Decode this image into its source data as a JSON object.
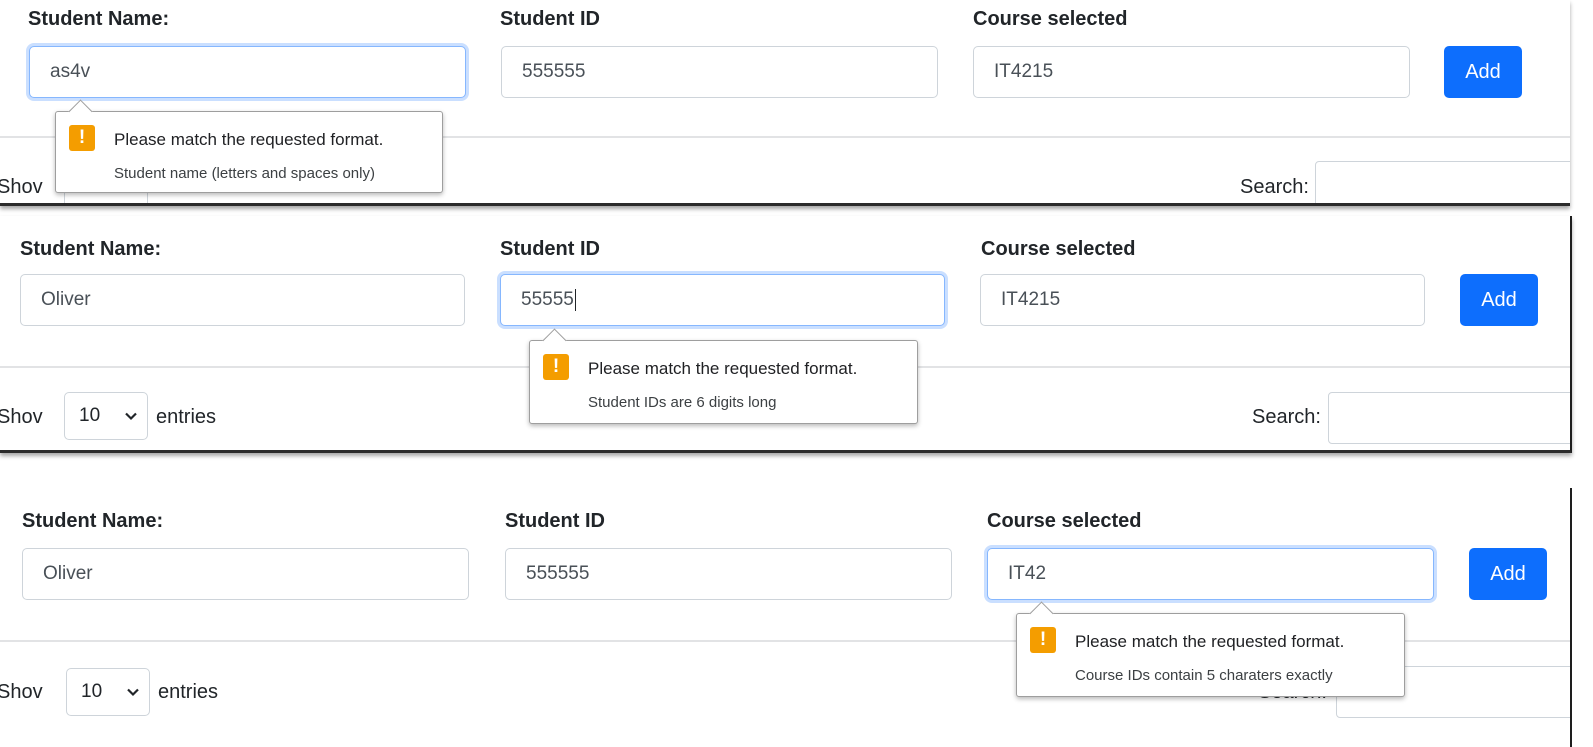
{
  "labels": {
    "student_name": "Student Name:",
    "student_id": "Student ID",
    "course": "Course selected",
    "add": "Add",
    "show": "Show",
    "show_partial": "Shov",
    "entries": "entries",
    "search": "Search:",
    "page_length": "10"
  },
  "icons": {
    "warning": "exclamation-warning-icon",
    "dropdown": "chevron-down-icon"
  },
  "colors": {
    "primary": "#0d6efd",
    "warning": "#f49d00",
    "focus": "#86b7fe"
  },
  "panels": [
    {
      "student_name_value": "as4v",
      "student_id_value": "555555",
      "course_value": "IT4215",
      "tooltip": {
        "message": "Please match the requested format.",
        "hint": "Student name (letters and spaces only)"
      }
    },
    {
      "student_name_value": "Oliver",
      "student_id_value": "55555",
      "course_value": "IT4215",
      "tooltip": {
        "message": "Please match the requested format.",
        "hint": "Student IDs are 6 digits long"
      }
    },
    {
      "student_name_value": "Oliver",
      "student_id_value": "555555",
      "course_value": "IT42",
      "tooltip": {
        "message": "Please match the requested format.",
        "hint": "Course IDs contain 5 charaters exactly"
      }
    }
  ]
}
